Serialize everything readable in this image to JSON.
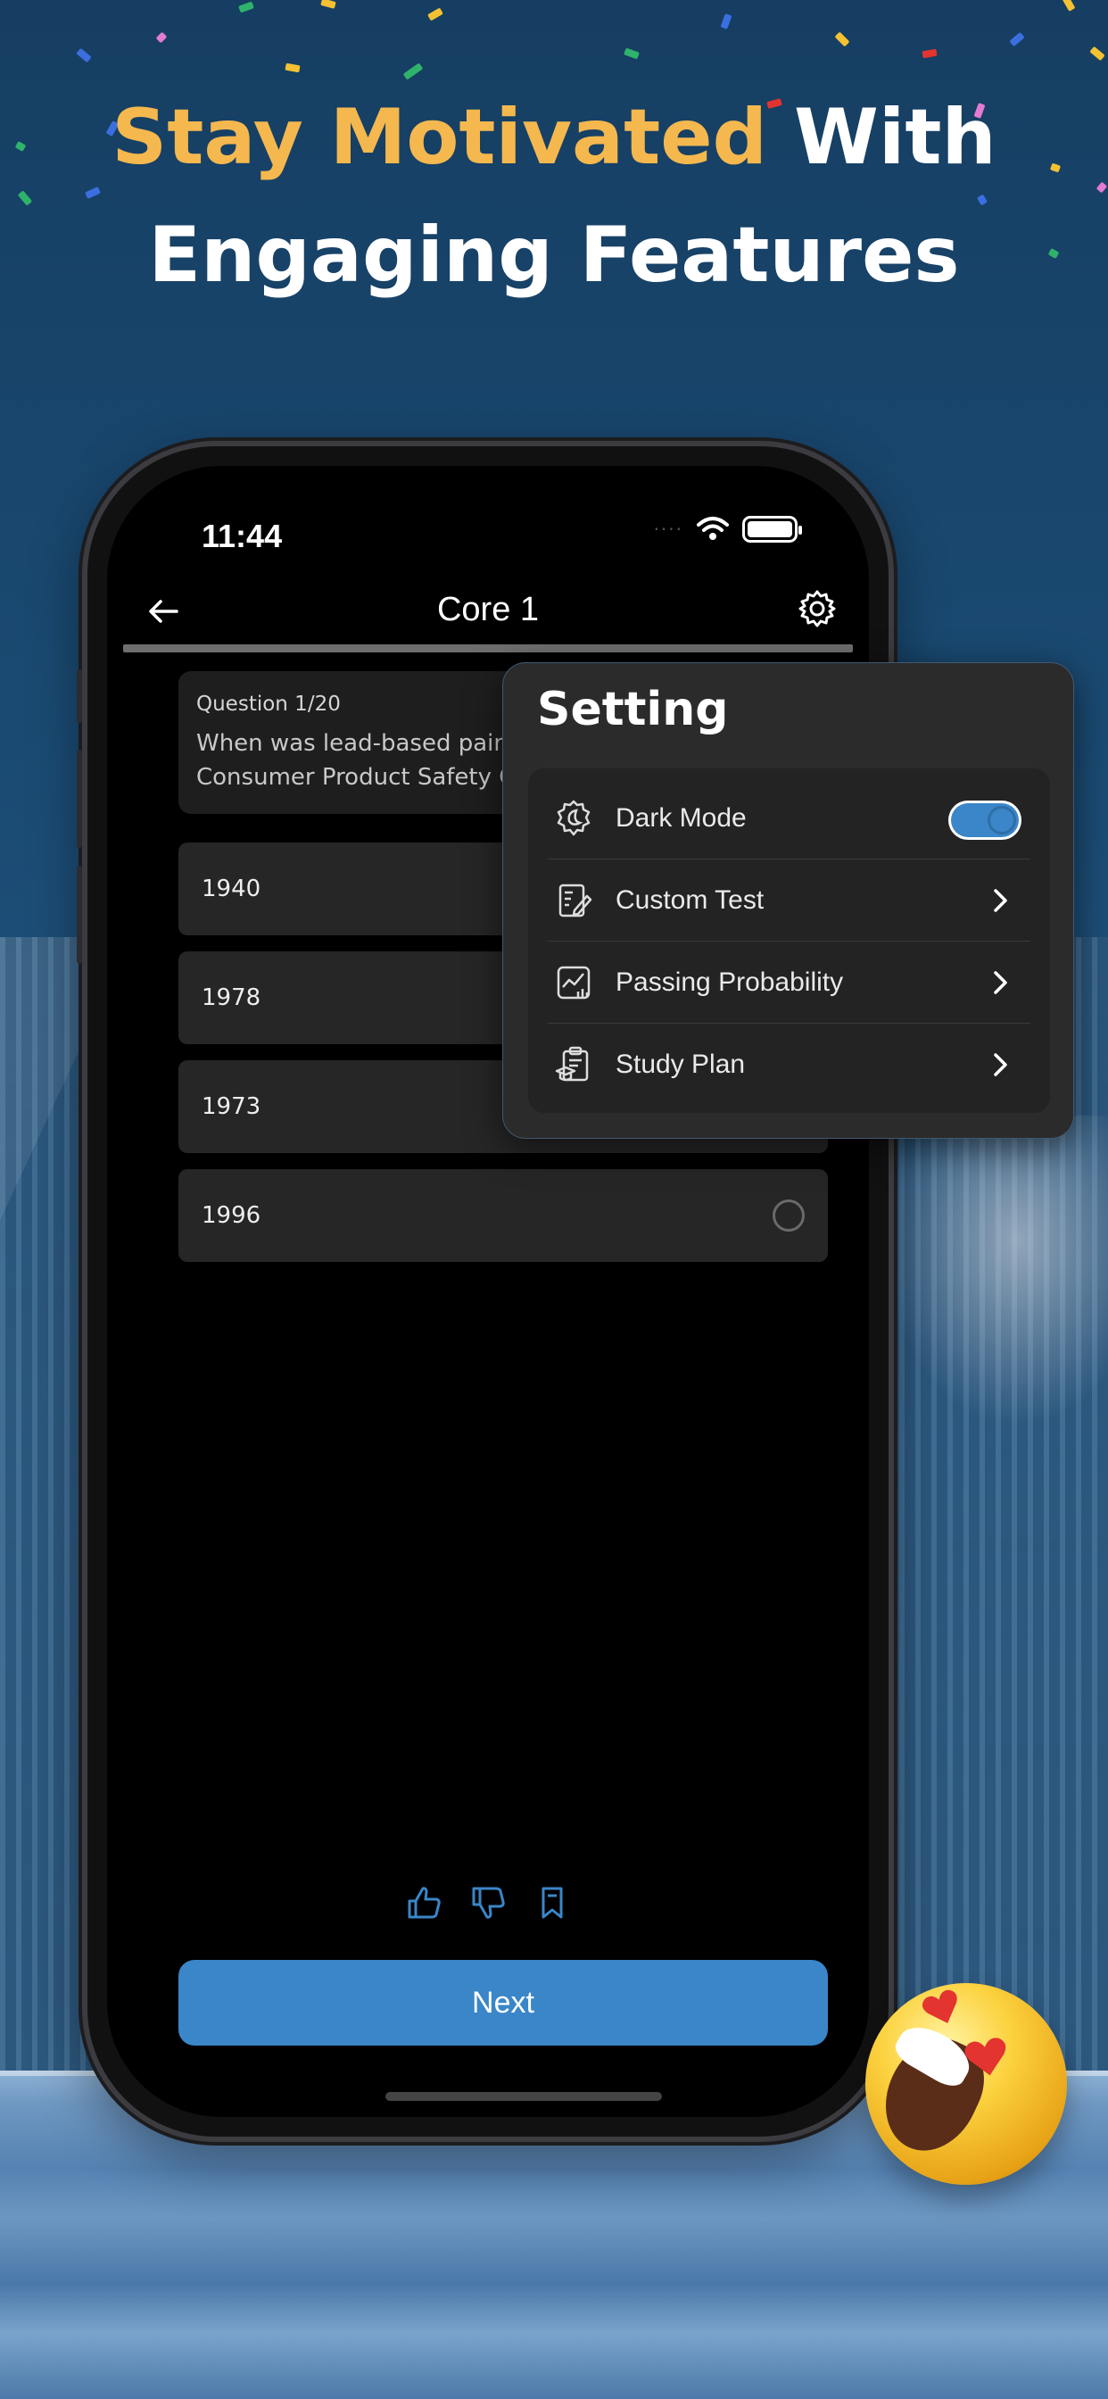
{
  "headline": {
    "accent": "Stay Motivated",
    "line1_rest": " With",
    "line2": "Engaging Features"
  },
  "status_bar": {
    "time": "11:44"
  },
  "nav": {
    "title": "Core 1"
  },
  "question": {
    "number": "Question 1/20",
    "text_line1": "When was lead-based pain",
    "text_line2": "Consumer Product Safety C"
  },
  "options": [
    "1940",
    "1978",
    "1973",
    "1996"
  ],
  "next_button": "Next",
  "settings": {
    "title": "Setting",
    "items": [
      {
        "label": "Dark Mode",
        "icon": "theme-icon",
        "toggle_on": true
      },
      {
        "label": "Custom Test",
        "icon": "custom-test-icon"
      },
      {
        "label": "Passing Probability",
        "icon": "chart-icon"
      },
      {
        "label": "Study Plan",
        "icon": "study-plan-icon"
      }
    ]
  },
  "colors": {
    "accent": "#f4b84e",
    "primary": "#3a86c8",
    "background": "#1a4a72"
  }
}
